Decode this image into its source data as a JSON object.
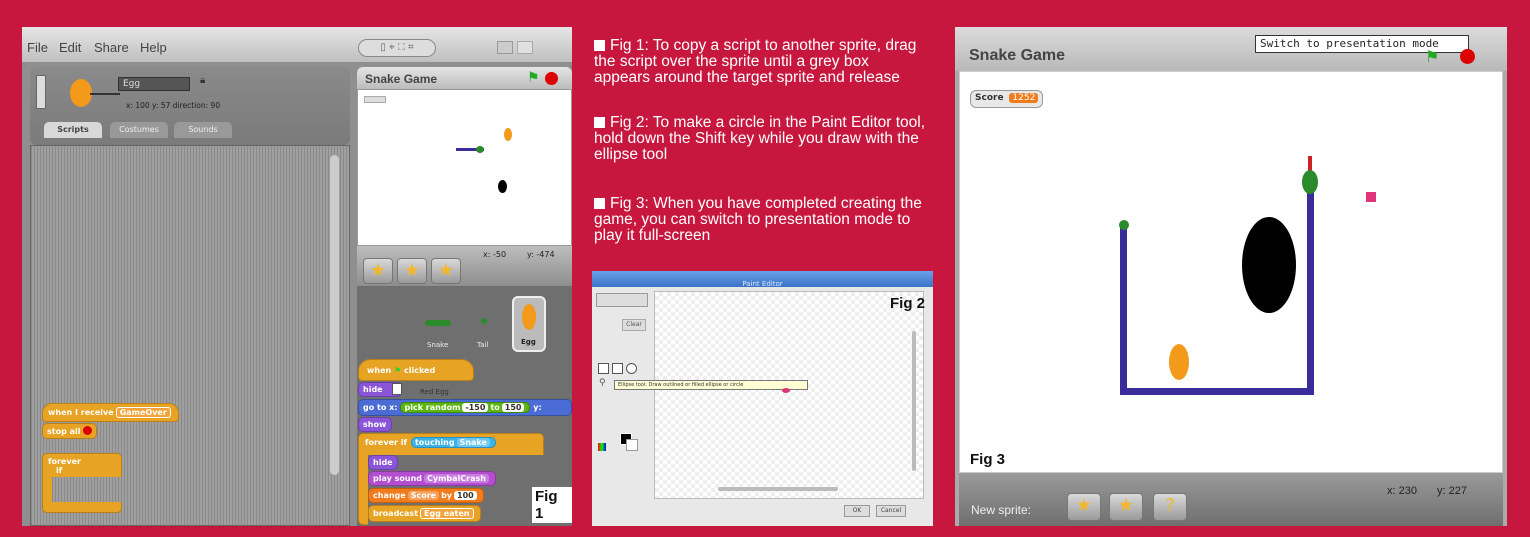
{
  "fig1": {
    "menu": [
      "File",
      "Edit",
      "Share",
      "Help"
    ],
    "sprite_name": "Egg",
    "sprite_info": "x: 100  y: 57   direction: 90",
    "tabs": [
      "Scripts",
      "Costumes",
      "Sounds"
    ],
    "stage_title": "Snake Game",
    "coords": {
      "x": "x: -50",
      "y": "y: -474"
    },
    "sprites": [
      "Snake",
      "Tail",
      "Egg"
    ],
    "left_script": {
      "when_receive": "when I receive",
      "message": "GameOver",
      "stop_all": "stop all",
      "forever": "forever",
      "if": "if"
    },
    "script": {
      "hat": "when",
      "hat_after": "clicked",
      "hide": "hide",
      "tooltip": "Red Egg",
      "goto": "go to x:",
      "goto_fn": "pick random",
      "goto_from": "-150",
      "goto_to_word": "to",
      "goto_to": "150",
      "goto_y": "y:",
      "show": "show",
      "forever_if": "forever if",
      "touching": "touching",
      "touching_target": "Snake",
      "hide2": "hide",
      "play_sound": "play sound",
      "sound": "CymbalCrash",
      "change": "change",
      "var": "Score",
      "by": "by",
      "amount": "100",
      "broadcast": "broadcast",
      "bmsg": "Egg eaten"
    },
    "label": "Fig 1"
  },
  "captions": [
    "Fig 1: To copy a script to another sprite, drag the script over the sprite until a grey box appears around the target sprite and release",
    "Fig 2: To make a circle in the Paint Editor tool, hold down the Shift key while you draw with the ellipse tool",
    "Fig 3: When you have completed creating the game, you can switch to presentation mode to play it full-screen"
  ],
  "fig2": {
    "title": "Paint Editor",
    "tooltip": "Ellipse tool: Draw outlined or filled ellipse or circle",
    "clear": "Clear",
    "ok": "OK",
    "cancel": "Cancel",
    "label": "Fig 2"
  },
  "fig3": {
    "title": "Snake Game",
    "tooltip": "Switch to presentation mode",
    "score_label": "Score",
    "score_value": "1252",
    "coords_x": "x: 230",
    "coords_y": "y: 227",
    "new_sprite": "New sprite:",
    "label": "Fig 3"
  },
  "colors": {
    "background": "#c8173e",
    "snake": "#3a2c9a",
    "egg": "#f39a1a",
    "pink": "#e0347a"
  }
}
